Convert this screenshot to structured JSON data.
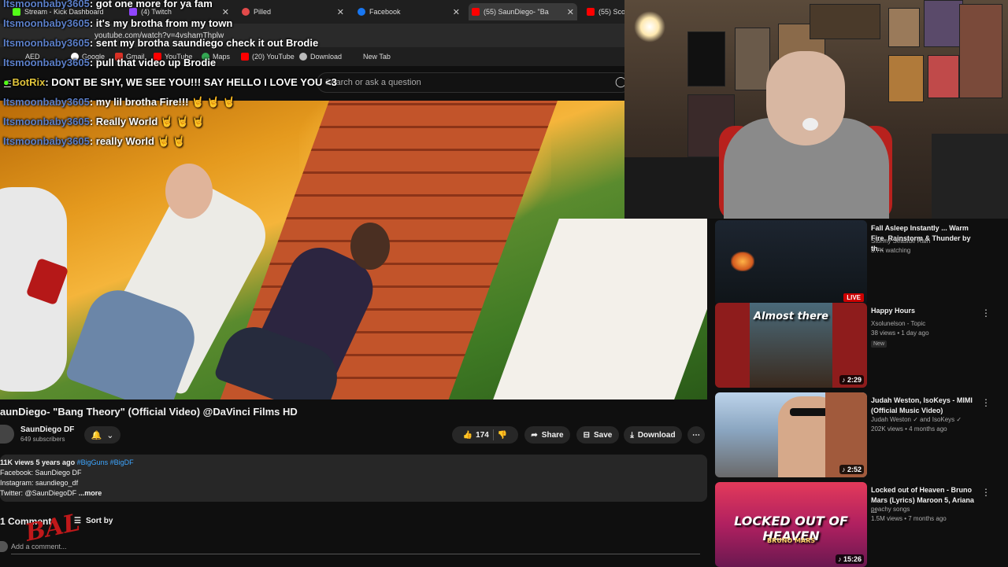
{
  "browser": {
    "tabs": [
      {
        "label": "Stream - Kick Dashboard",
        "icon": "kick-icon"
      },
      {
        "label": "(4) Twitch",
        "icon": "twitch-icon"
      },
      {
        "label": "Pilled",
        "icon": "pilled-icon"
      },
      {
        "label": "Facebook",
        "icon": "facebook-icon"
      },
      {
        "label": "(55) SaunDiego- \"Ba",
        "icon": "youtube-icon"
      },
      {
        "label": "(55) Sco",
        "icon": "youtube-icon"
      }
    ],
    "url": "youtube.com/watch?v=4vshamThplw",
    "bookmarks": [
      "AED",
      "Google",
      "Gmail",
      "YouTube",
      "Maps",
      "(20) YouTube",
      "Download",
      "New Tab"
    ]
  },
  "youtube": {
    "search_placeholder": "Search or ask a question"
  },
  "chat": [
    {
      "user": "Itsmoonbaby3605",
      "message": ": got one more for ya fam",
      "emotes": ""
    },
    {
      "user": "Itsmoonbaby3605",
      "message": ": it's my brotha from my town",
      "emotes": ""
    },
    {
      "user": "Itsmoonbaby3605",
      "message": ": sent my brotha saundiego check it out Brodie",
      "emotes": ""
    },
    {
      "user": "Itsmoonbaby3605",
      "message": ": pull that video up Brodie",
      "emotes": ""
    },
    {
      "user": "BotRix",
      "message": ": DONT BE SHY, WE SEE YOU!!! SAY HELLO I LOVE YOU <3",
      "emotes": ""
    },
    {
      "user": "Itsmoonbaby3605",
      "message": ": my lil brotha Fire!!!",
      "emotes": "🤘 🤘 🤘"
    },
    {
      "user": "Itsmoonbaby3605",
      "message": ": Really World",
      "emotes": "🤘 🤘 🤘"
    },
    {
      "user": "Itsmoonbaby3605",
      "message": ": really World",
      "emotes": "🤘 🤘"
    }
  ],
  "video": {
    "title": "aunDiego- \"Bang Theory\" (Official Video) @DaVinci Films HD",
    "channel": "SaunDiego DF",
    "subscribers": "649 subscribers",
    "likes": "174",
    "share_label": "Share",
    "save_label": "Save",
    "download_label": "Download",
    "views_line": "11K views  5 years ago",
    "hashtags": "#BigGuns #BigDF",
    "desc_line1": "Facebook: SaunDiego DF",
    "desc_line2": "Instagram: saundiego_df",
    "desc_line3": "Twitter: @SaunDiegoDF",
    "more_label": "...more",
    "comments_label": "1 Comment",
    "sort_label": "Sort by",
    "add_comment_placeholder": "Add a comment..."
  },
  "overlay_logo": "BAL",
  "recommendations": [
    {
      "title": "Fall Asleep Instantly ... Warm Fire, Rainstorm & Thunder by th...",
      "channel": "Stormy Seaside Rain",
      "meta": "3.7K watching",
      "duration": "",
      "live": "LIVE",
      "badge": ""
    },
    {
      "title": "Happy Hours",
      "channel": "Xsolunelson - Topic",
      "meta": "38 views • 1 day ago",
      "duration": "2:29",
      "live": "",
      "badge": "New",
      "thumb_text": "Almost there"
    },
    {
      "title": "Judah Weston, IsoKeys - MIMI (Official Music Video)",
      "channel": "Judah Weston ✓ and IsoKeys ✓",
      "meta": "202K views • 4 months ago",
      "duration": "2:52",
      "live": "",
      "badge": ""
    },
    {
      "title": "Locked out of Heaven - Bruno Mars (Lyrics) Maroon 5, Ariana ...",
      "channel": "peachy songs",
      "meta": "1.5M views • 7 months ago",
      "duration": "15:26",
      "live": "",
      "badge": "",
      "thumb_text": "LOCKED OUT OF HEAVEN",
      "thumb_sub": "BRUNO MARS"
    }
  ]
}
